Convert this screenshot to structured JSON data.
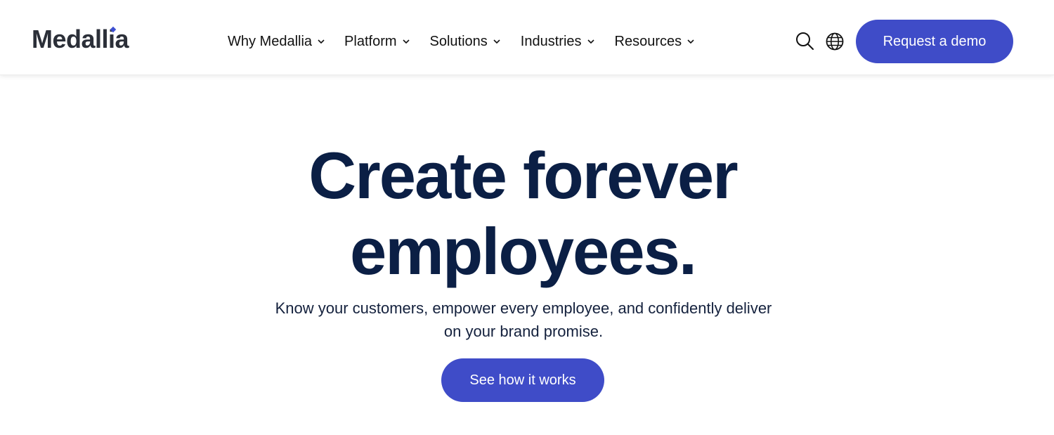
{
  "header": {
    "logo_text": "Medallia",
    "nav": [
      {
        "label": "Why Medallia",
        "icon": "chevron-down-icon"
      },
      {
        "label": "Platform",
        "icon": "chevron-down-icon"
      },
      {
        "label": "Solutions",
        "icon": "chevron-down-icon"
      },
      {
        "label": "Industries",
        "icon": "chevron-down-icon"
      },
      {
        "label": "Resources",
        "icon": "chevron-down-icon"
      }
    ],
    "icons": [
      "search-icon",
      "globe-icon"
    ],
    "cta_label": "Request a demo"
  },
  "hero": {
    "title_line1": "Create forever",
    "title_line2": "employees.",
    "subtitle_line1": "Know your customers, empower every employee, and confidently deliver",
    "subtitle_line2": "on your brand promise.",
    "cta_label": "See how it works"
  },
  "colors": {
    "accent": "#3f4cc8",
    "heading": "#0b1f45",
    "logo": "#2b2f38",
    "logo_dot": "#3d4fd1"
  }
}
